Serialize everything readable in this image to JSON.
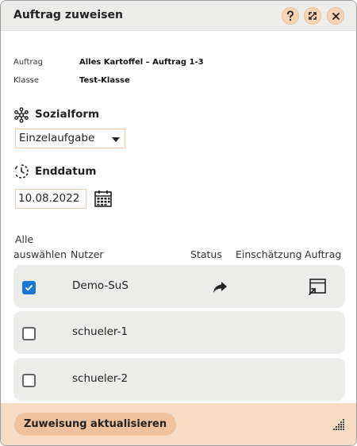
{
  "dialog": {
    "title": "Auftrag zuweisen",
    "help_icon": "question-mark-icon",
    "maximize_icon": "maximize-icon",
    "close_icon": "close-icon"
  },
  "info": {
    "auftrag_label": "Auftrag",
    "auftrag_value": "Alles Kartoffel – Auftrag 1-3",
    "klasse_label": "Klasse",
    "klasse_value": "Test-Klasse"
  },
  "sozialform": {
    "title": "Sozialform",
    "icon": "molecule-icon",
    "selected": "Einzelaufgabe"
  },
  "enddatum": {
    "title": "Enddatum",
    "icon": "clock-icon",
    "value": "10.08.2022",
    "calendar_icon": "calendar-icon"
  },
  "table": {
    "col_select_line1": "Alle",
    "col_select_line2": "auswählen",
    "col_user": "Nutzer",
    "col_status": "Status",
    "col_assessment": "Einschätzung",
    "col_task": "Auftrag",
    "rows": [
      {
        "name": "Demo-SuS",
        "checked": true,
        "status_icon": "share-arrow-icon",
        "task_icon": "open-window-icon"
      },
      {
        "name": "schueler-1",
        "checked": false
      },
      {
        "name": "schueler-2",
        "checked": false
      }
    ]
  },
  "footer": {
    "update_label": "Zuweisung aktualisieren",
    "resize_icon": "resize-grip-icon"
  },
  "colors": {
    "accent": "#efc29d",
    "footer_bg": "#f6dcc4",
    "checkbox_checked": "#1976d2"
  }
}
